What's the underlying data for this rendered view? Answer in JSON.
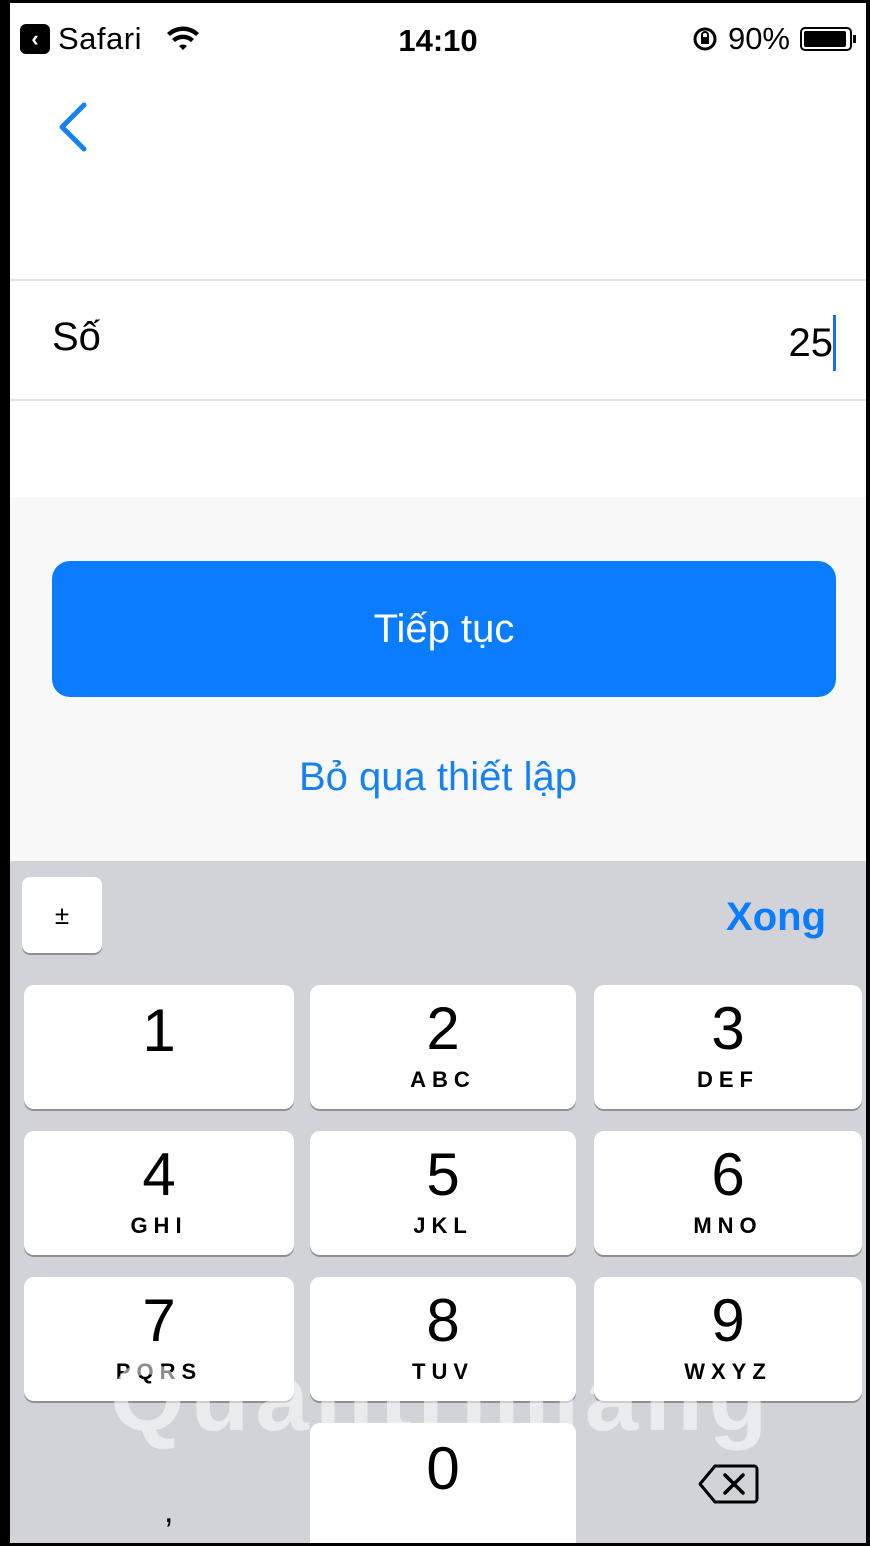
{
  "status_bar": {
    "app_name": "Safari",
    "time": "14:10",
    "battery": "90%"
  },
  "form": {
    "field_label": "Số",
    "field_value": "25"
  },
  "actions": {
    "primary_label": "Tiếp tục",
    "skip_label": "Bỏ qua thiết lập"
  },
  "keyboard": {
    "plus_minus_label": "±",
    "done_label": "Xong",
    "keys": [
      {
        "num": "1",
        "letters": ""
      },
      {
        "num": "2",
        "letters": "ABC"
      },
      {
        "num": "3",
        "letters": "DEF"
      },
      {
        "num": "4",
        "letters": "GHI"
      },
      {
        "num": "5",
        "letters": "JKL"
      },
      {
        "num": "6",
        "letters": "MNO"
      },
      {
        "num": "7",
        "letters": "PQRS"
      },
      {
        "num": "8",
        "letters": "TUV"
      },
      {
        "num": "9",
        "letters": "WXYZ"
      },
      {
        "num": "0",
        "letters": ""
      }
    ],
    "comma_label": ","
  },
  "watermark": "Quantrimang",
  "colors": {
    "accent": "#0a7cff",
    "link": "#1681f2",
    "keyboard_bg": "#d1d3d9"
  }
}
